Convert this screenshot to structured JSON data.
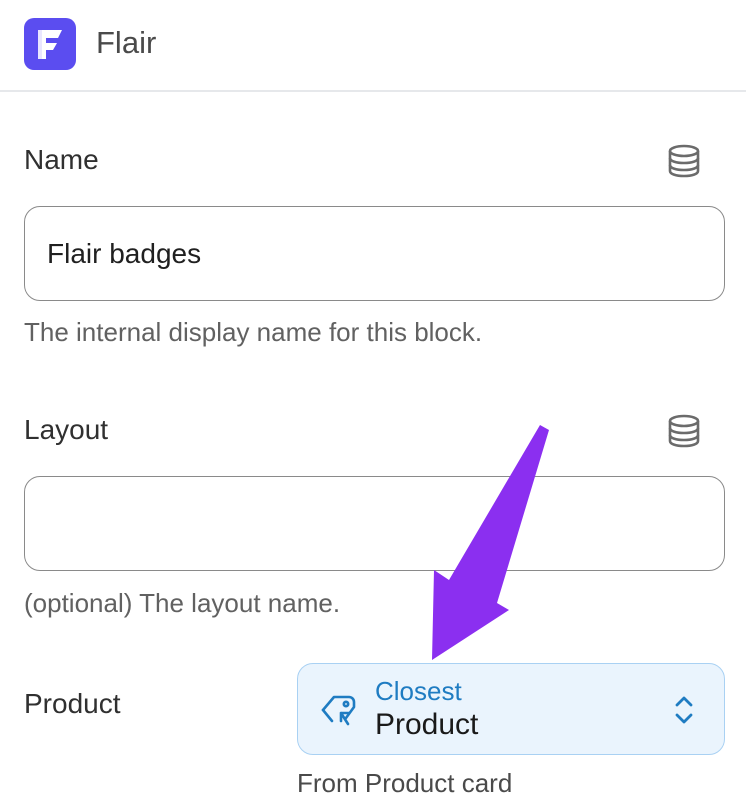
{
  "app": {
    "title": "Flair",
    "logo_icon": "flair-logo-icon"
  },
  "fields": {
    "name": {
      "label": "Name",
      "value": "Flair badges",
      "help": "The internal display name for this block.",
      "icon": "database-icon"
    },
    "layout": {
      "label": "Layout",
      "value": "",
      "help": "(optional) The layout name.",
      "icon": "database-icon"
    },
    "product": {
      "label": "Product",
      "source_mode": "Closest",
      "source_value": "Product",
      "caption": "From Product card",
      "icon": "tag-icon",
      "chevron": "chevron-up-down-icon"
    }
  },
  "annotation": {
    "arrow_color": "#8b2ff0",
    "arrow_icon": "arrow-annotation"
  },
  "colors": {
    "brand": "#5b4df0",
    "select_bg": "#eaf4fd",
    "select_border": "#a9d1f3",
    "select_accent": "#1f7cc2"
  }
}
